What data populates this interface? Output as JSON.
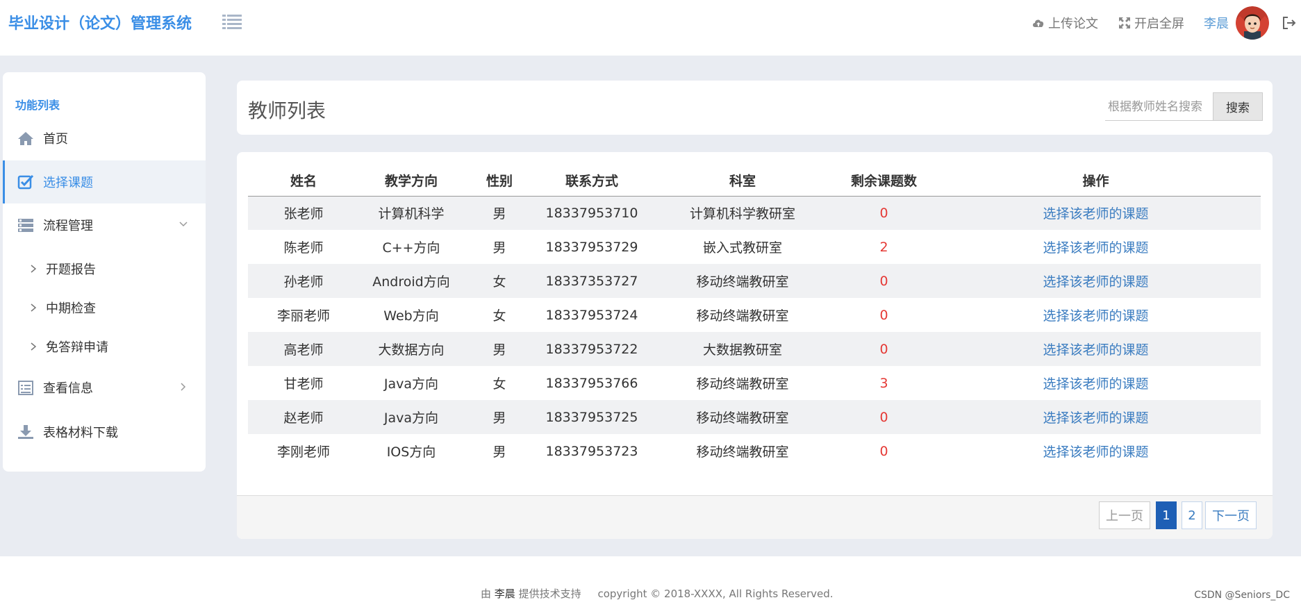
{
  "header": {
    "brand": "毕业设计（论文）管理系统",
    "upload_label": "上传论文",
    "fullscreen_label": "开启全屏",
    "username": "李晨"
  },
  "sidebar": {
    "title": "功能列表",
    "items": [
      {
        "label": "首页",
        "icon": "home-icon"
      },
      {
        "label": "选择课题",
        "icon": "checkbox-icon",
        "active": true
      },
      {
        "label": "流程管理",
        "icon": "process-icon"
      },
      {
        "label": "开题报告"
      },
      {
        "label": "中期检查"
      },
      {
        "label": "免答辩申请"
      },
      {
        "label": "查看信息",
        "icon": "list-icon"
      },
      {
        "label": "表格材料下载",
        "icon": "download-icon"
      }
    ]
  },
  "main": {
    "title": "教师列表",
    "search_placeholder": "根据教师姓名搜索",
    "search_button": "搜索",
    "columns": [
      "姓名",
      "教学方向",
      "性别",
      "联系方式",
      "科室",
      "剩余课题数",
      "操作"
    ],
    "rows": [
      {
        "name": "张老师",
        "direction": "计算机科学",
        "gender": "男",
        "phone": "18337953710",
        "dept": "计算机科学教研室",
        "remaining": "0",
        "action": "选择该老师的课题"
      },
      {
        "name": "陈老师",
        "direction": "C++方向",
        "gender": "男",
        "phone": "18337953729",
        "dept": "嵌入式教研室",
        "remaining": "2",
        "action": "选择该老师的课题"
      },
      {
        "name": "孙老师",
        "direction": "Android方向",
        "gender": "女",
        "phone": "18337353727",
        "dept": "移动终端教研室",
        "remaining": "0",
        "action": "选择该老师的课题"
      },
      {
        "name": "李丽老师",
        "direction": "Web方向",
        "gender": "女",
        "phone": "18337953724",
        "dept": "移动终端教研室",
        "remaining": "0",
        "action": "选择该老师的课题"
      },
      {
        "name": "高老师",
        "direction": "大数据方向",
        "gender": "男",
        "phone": "18337953722",
        "dept": "大数据教研室",
        "remaining": "0",
        "action": "选择该老师的课题"
      },
      {
        "name": "甘老师",
        "direction": "Java方向",
        "gender": "女",
        "phone": "18337953766",
        "dept": "移动终端教研室",
        "remaining": "3",
        "action": "选择该老师的课题"
      },
      {
        "name": "赵老师",
        "direction": "Java方向",
        "gender": "男",
        "phone": "18337953725",
        "dept": "移动终端教研室",
        "remaining": "0",
        "action": "选择该老师的课题"
      },
      {
        "name": "李刚老师",
        "direction": "IOS方向",
        "gender": "男",
        "phone": "18337953723",
        "dept": "移动终端教研室",
        "remaining": "0",
        "action": "选择该老师的课题"
      }
    ],
    "pagination": {
      "prev": "上一页",
      "pages": [
        "1",
        "2"
      ],
      "current": "1",
      "next": "下一页"
    }
  },
  "footer": {
    "prefix": "由",
    "author": "李晨",
    "suffix": "提供技术支持",
    "copyright": "copyright © 2018-XXXX, All Rights Reserved.",
    "watermark": "CSDN @Seniors_DC"
  },
  "colors": {
    "accent": "#3a8ee6",
    "link": "#3a7cc0",
    "danger": "#e53935",
    "active_page": "#1e5fb5"
  }
}
